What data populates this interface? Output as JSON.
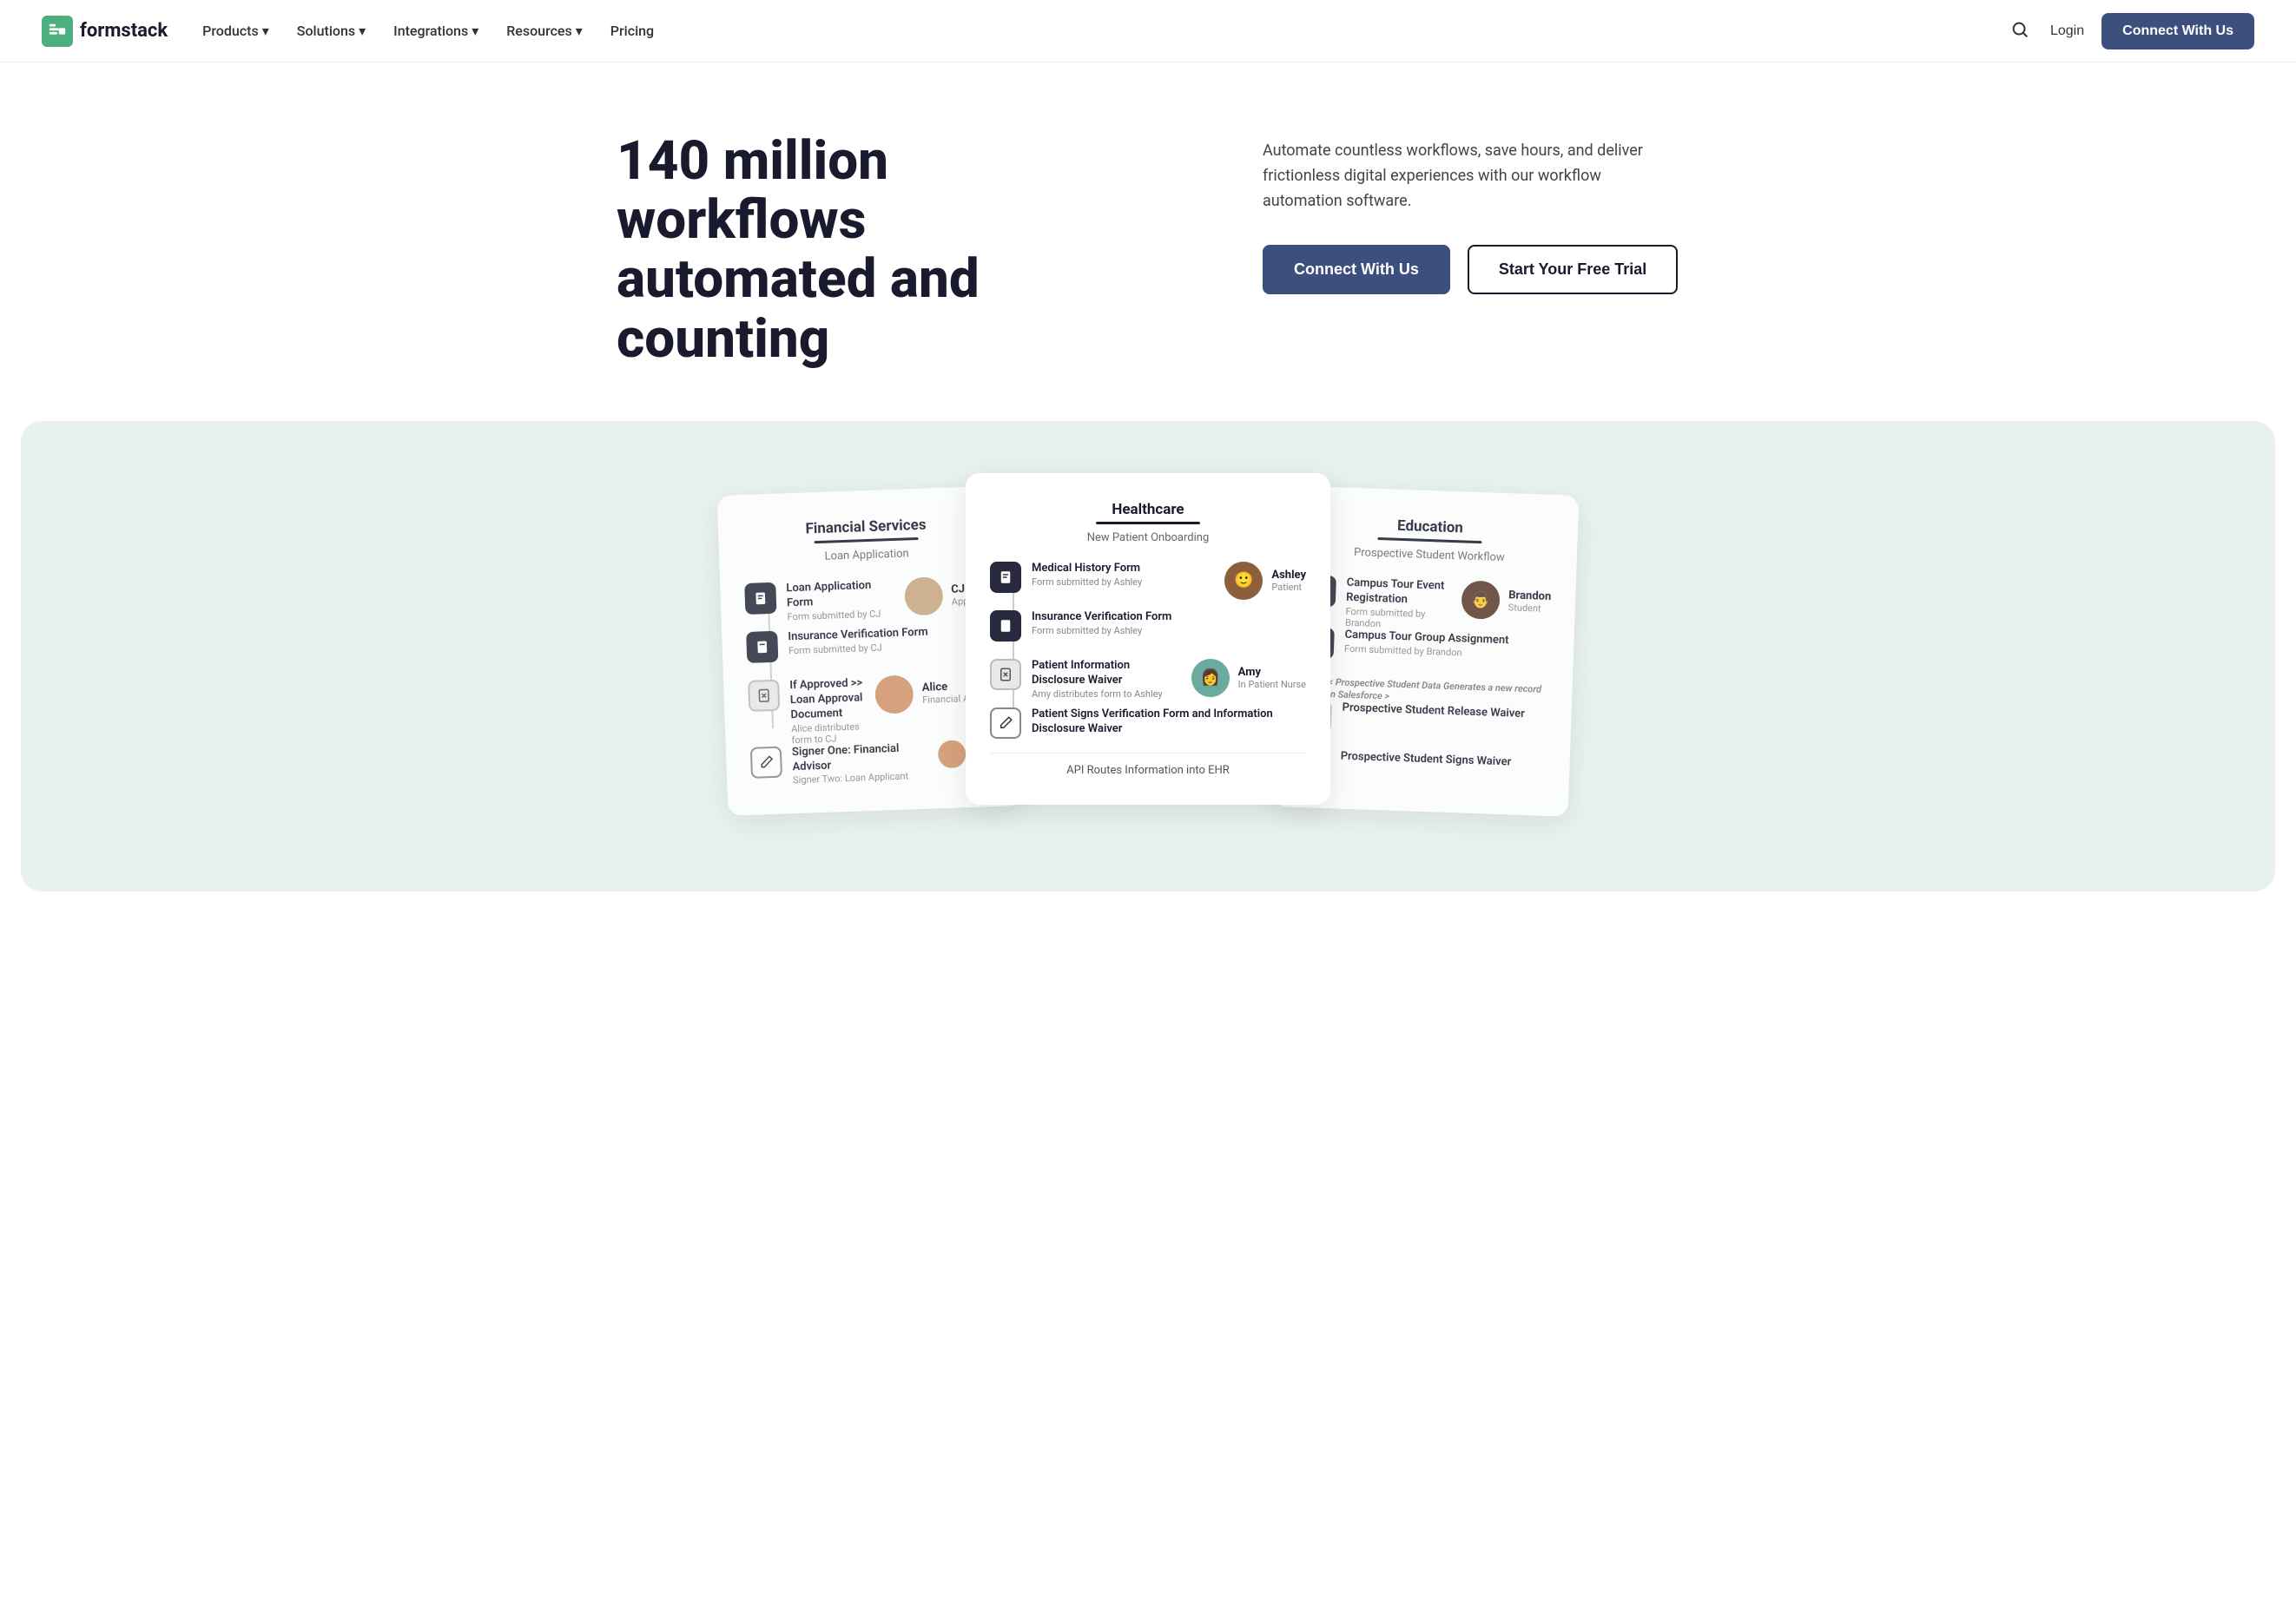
{
  "nav": {
    "logo_text": "formstack",
    "links": [
      "Products",
      "Solutions",
      "Integrations",
      "Resources",
      "Pricing"
    ],
    "login_label": "Login",
    "connect_label": "Connect With Us"
  },
  "hero": {
    "title": "140 million workflows automated and counting",
    "description": "Automate countless workflows, save hours, and deliver frictionless digital experiences with our workflow automation software.",
    "btn_connect": "Connect With Us",
    "btn_trial": "Start Your Free Trial"
  },
  "demo": {
    "cards": [
      {
        "id": "financial",
        "industry": "Financial Services",
        "subtitle": "Loan Application",
        "steps": [
          {
            "icon": "doc",
            "title": "Loan Application Form",
            "desc": "Form submitted by CJ"
          },
          {
            "icon": "doc",
            "title": "Insurance Verification Form",
            "desc": "Form submitted by CJ"
          },
          {
            "icon": "doc-x",
            "title": "If Approved >> Loan Approval Document",
            "desc": "Alice distributes form to CJ"
          },
          {
            "icon": "pen",
            "title": "Signer One: Financial Advisor\nSigner Two: Loan Applicant",
            "desc": ""
          }
        ],
        "persons": [
          {
            "name": "CJ",
            "role": "Applicant",
            "color": "#c8a882"
          },
          {
            "name": "Alice",
            "role": "Financial Advisor",
            "color": "#d4956a"
          }
        ]
      },
      {
        "id": "healthcare",
        "industry": "Healthcare",
        "subtitle": "New Patient Onboarding",
        "steps": [
          {
            "icon": "doc",
            "title": "Medical History Form",
            "desc": "Form submitted by Ashley"
          },
          {
            "icon": "doc",
            "title": "Insurance Verification Form",
            "desc": "Form submitted by Ashley"
          },
          {
            "icon": "doc-x",
            "title": "Patient Information Disclosure Waiver",
            "desc": "Amy distributes form to Ashley"
          },
          {
            "icon": "pen",
            "title": "Patient Signs Verification Form and Information Disclosure Waiver",
            "desc": ""
          }
        ],
        "persons": [
          {
            "name": "Ashley",
            "role": "Patient",
            "color": "#8b5e3c"
          },
          {
            "name": "Amy",
            "role": "In Patient Nurse",
            "color": "#6aab9e"
          }
        ],
        "api_note": "API Routes Information into EHR"
      },
      {
        "id": "education",
        "industry": "Education",
        "subtitle": "Prospective Student Workflow",
        "steps": [
          {
            "icon": "doc",
            "title": "Campus Tour Event Registration",
            "desc": "Form submitted by Brandon"
          },
          {
            "icon": "doc",
            "title": "Campus Tour Group Assignment",
            "desc": "Form submitted by Brandon"
          },
          {
            "icon": "info",
            "title": "< Prospective Student Data Generates a new record in Salesforce >",
            "desc": ""
          },
          {
            "icon": "doc-x",
            "title": "Prospective Student Release Waiver",
            "desc": ""
          },
          {
            "icon": "pen",
            "title": "Prospective Student Signs Waiver",
            "desc": ""
          }
        ],
        "persons": [
          {
            "name": "Brandon",
            "role": "Student",
            "color": "#5a3a2e"
          }
        ]
      }
    ]
  }
}
